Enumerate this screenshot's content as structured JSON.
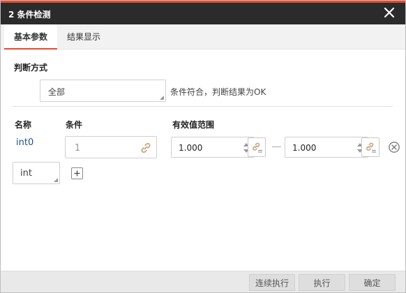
{
  "dialog": {
    "title": "2 条件检测",
    "accent_color": "#e8492b"
  },
  "tabs": [
    {
      "label": "基本参数",
      "active": true
    },
    {
      "label": "结果显示",
      "active": false
    }
  ],
  "judge": {
    "label": "判断方式",
    "selected": "全部",
    "hint": "条件符合，判断结果为OK"
  },
  "columns": {
    "name": "名称",
    "condition": "条件",
    "range": "有效值范围"
  },
  "row": {
    "name": "int0",
    "condition_value": "1",
    "range_min": "1.000",
    "range_max": "1.000"
  },
  "type_select": {
    "selected": "int"
  },
  "footer": {
    "continuous_run": "连续执行",
    "run": "执行",
    "confirm": "确定"
  },
  "icons": {
    "close": "close-icon",
    "link": "link-icon",
    "bind": "link-settings-icon",
    "spin": "spinner-arrows-icon",
    "remove": "remove-circle-icon",
    "add": "plus-icon"
  }
}
